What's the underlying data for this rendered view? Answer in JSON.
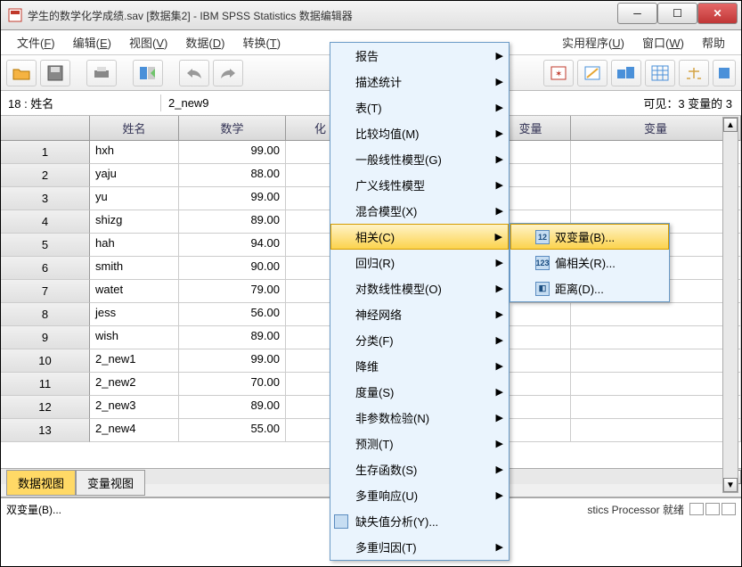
{
  "window": {
    "title": "学生的数学化学成绩.sav [数据集2] - IBM SPSS Statistics 数据编辑器"
  },
  "menubar": {
    "file": "文件(F)",
    "edit": "编辑(E)",
    "view": "视图(V)",
    "data": "数据(D)",
    "transform": "转换(T)",
    "utilities": "实用程序(U)",
    "window": "窗口(W)",
    "help": "帮助"
  },
  "cellref": {
    "label": "18 : 姓名",
    "value": "2_new9",
    "visible": "可见：3 变量的 3"
  },
  "columns": {
    "name": "姓名",
    "math": "数学",
    "partial": "化",
    "var": "变量"
  },
  "rows": [
    {
      "n": "1",
      "name": "hxh",
      "math": "99.00"
    },
    {
      "n": "2",
      "name": "yaju",
      "math": "88.00"
    },
    {
      "n": "3",
      "name": "yu",
      "math": "99.00"
    },
    {
      "n": "4",
      "name": "shizg",
      "math": "89.00"
    },
    {
      "n": "5",
      "name": "hah",
      "math": "94.00"
    },
    {
      "n": "6",
      "name": "smith",
      "math": "90.00"
    },
    {
      "n": "7",
      "name": "watet",
      "math": "79.00"
    },
    {
      "n": "8",
      "name": "jess",
      "math": "56.00"
    },
    {
      "n": "9",
      "name": "wish",
      "math": "89.00"
    },
    {
      "n": "10",
      "name": "2_new1",
      "math": "99.00"
    },
    {
      "n": "11",
      "name": "2_new2",
      "math": "70.00"
    },
    {
      "n": "12",
      "name": "2_new3",
      "math": "89.00"
    },
    {
      "n": "13",
      "name": "2_new4",
      "math": "55.00"
    }
  ],
  "tabs": {
    "data": "数据视图",
    "variable": "变量视图"
  },
  "status": {
    "left": "双变量(B)...",
    "processor": "stics Processor 就绪"
  },
  "mainmenu": [
    {
      "label": "报告",
      "arrow": true
    },
    {
      "label": "描述统计",
      "arrow": true
    },
    {
      "label": "表(T)",
      "arrow": true
    },
    {
      "label": "比较均值(M)",
      "arrow": true
    },
    {
      "label": "一般线性模型(G)",
      "arrow": true
    },
    {
      "label": "广义线性模型",
      "arrow": true
    },
    {
      "label": "混合模型(X)",
      "arrow": true
    },
    {
      "label": "相关(C)",
      "arrow": true,
      "highlight": true
    },
    {
      "label": "回归(R)",
      "arrow": true
    },
    {
      "label": "对数线性模型(O)",
      "arrow": true
    },
    {
      "label": "神经网络",
      "arrow": true
    },
    {
      "label": "分类(F)",
      "arrow": true
    },
    {
      "label": "降维",
      "arrow": true
    },
    {
      "label": "度量(S)",
      "arrow": true
    },
    {
      "label": "非参数检验(N)",
      "arrow": true
    },
    {
      "label": "预测(T)",
      "arrow": true
    },
    {
      "label": "生存函数(S)",
      "arrow": true
    },
    {
      "label": "多重响应(U)",
      "arrow": true
    },
    {
      "label": "缺失值分析(Y)...",
      "arrow": false,
      "icon": true
    },
    {
      "label": "多重归因(T)",
      "arrow": true
    }
  ],
  "submenu": [
    {
      "label": "双变量(B)...",
      "icon": "12",
      "highlight": true
    },
    {
      "label": "偏相关(R)...",
      "icon": "123"
    },
    {
      "label": "距离(D)...",
      "icon": "◧"
    }
  ]
}
